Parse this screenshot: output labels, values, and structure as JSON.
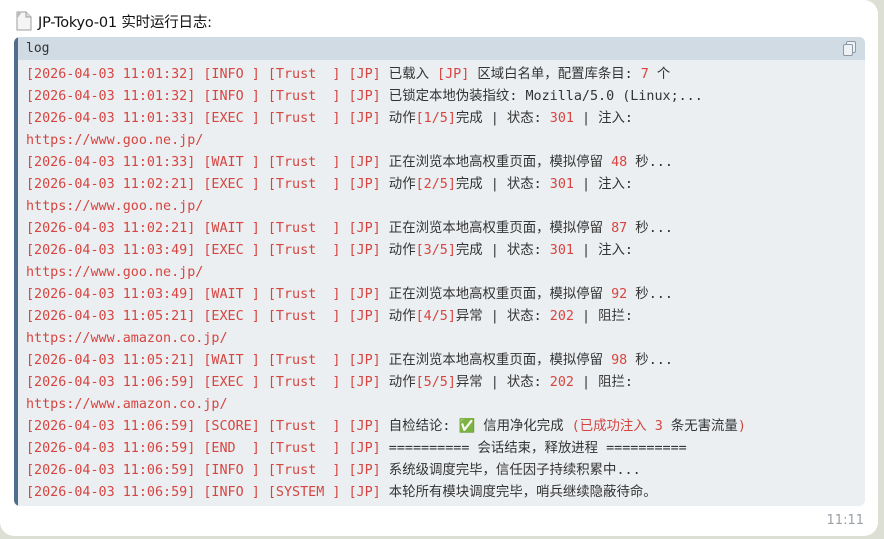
{
  "message": {
    "title": "JP-Tokyo-01 实时运行日志:",
    "timestamp": "11:11",
    "icon": "file-icon"
  },
  "code": {
    "language": "log",
    "copy_icon": "copy-icon",
    "lines": [
      {
        "parts": [
          [
            "b",
            "[2026-04-03 11:01:32]"
          ],
          [
            "t",
            " "
          ],
          [
            "b",
            "[INFO ]"
          ],
          [
            "t",
            " "
          ],
          [
            "b",
            "[Trust  ]"
          ],
          [
            "t",
            " "
          ],
          [
            "b",
            "[JP]"
          ],
          [
            "t",
            " 已载入 "
          ],
          [
            "b",
            "[JP]"
          ],
          [
            "t",
            " 区域白名单，配置库条目: "
          ],
          [
            "n",
            "7"
          ],
          [
            "t",
            " 个"
          ]
        ]
      },
      {
        "parts": [
          [
            "b",
            "[2026-04-03 11:01:32]"
          ],
          [
            "t",
            " "
          ],
          [
            "b",
            "[INFO ]"
          ],
          [
            "t",
            " "
          ],
          [
            "b",
            "[Trust  ]"
          ],
          [
            "t",
            " "
          ],
          [
            "b",
            "[JP]"
          ],
          [
            "t",
            " 已锁定本地伪装指纹: Mozilla/5.0 (Linux;..."
          ]
        ]
      },
      {
        "parts": [
          [
            "b",
            "[2026-04-03 11:01:33]"
          ],
          [
            "t",
            " "
          ],
          [
            "b",
            "[EXEC ]"
          ],
          [
            "t",
            " "
          ],
          [
            "b",
            "[Trust  ]"
          ],
          [
            "t",
            " "
          ],
          [
            "b",
            "[JP]"
          ],
          [
            "t",
            " 动作"
          ],
          [
            "b",
            "[1/5]"
          ],
          [
            "t",
            "完成 | 状态: "
          ],
          [
            "n",
            "301"
          ],
          [
            "t",
            " | 注入:"
          ]
        ]
      },
      {
        "parts": [
          [
            "u",
            "https://www.goo.ne.jp/"
          ]
        ]
      },
      {
        "parts": [
          [
            "b",
            "[2026-04-03 11:01:33]"
          ],
          [
            "t",
            " "
          ],
          [
            "b",
            "[WAIT ]"
          ],
          [
            "t",
            " "
          ],
          [
            "b",
            "[Trust  ]"
          ],
          [
            "t",
            " "
          ],
          [
            "b",
            "[JP]"
          ],
          [
            "t",
            " 正在浏览本地高权重页面，模拟停留 "
          ],
          [
            "n",
            "48"
          ],
          [
            "t",
            " 秒..."
          ]
        ]
      },
      {
        "parts": [
          [
            "b",
            "[2026-04-03 11:02:21]"
          ],
          [
            "t",
            " "
          ],
          [
            "b",
            "[EXEC ]"
          ],
          [
            "t",
            " "
          ],
          [
            "b",
            "[Trust  ]"
          ],
          [
            "t",
            " "
          ],
          [
            "b",
            "[JP]"
          ],
          [
            "t",
            " 动作"
          ],
          [
            "b",
            "[2/5]"
          ],
          [
            "t",
            "完成 | 状态: "
          ],
          [
            "n",
            "301"
          ],
          [
            "t",
            " | 注入:"
          ]
        ]
      },
      {
        "parts": [
          [
            "u",
            "https://www.goo.ne.jp/"
          ]
        ]
      },
      {
        "parts": [
          [
            "b",
            "[2026-04-03 11:02:21]"
          ],
          [
            "t",
            " "
          ],
          [
            "b",
            "[WAIT ]"
          ],
          [
            "t",
            " "
          ],
          [
            "b",
            "[Trust  ]"
          ],
          [
            "t",
            " "
          ],
          [
            "b",
            "[JP]"
          ],
          [
            "t",
            " 正在浏览本地高权重页面，模拟停留 "
          ],
          [
            "n",
            "87"
          ],
          [
            "t",
            " 秒..."
          ]
        ]
      },
      {
        "parts": [
          [
            "b",
            "[2026-04-03 11:03:49]"
          ],
          [
            "t",
            " "
          ],
          [
            "b",
            "[EXEC ]"
          ],
          [
            "t",
            " "
          ],
          [
            "b",
            "[Trust  ]"
          ],
          [
            "t",
            " "
          ],
          [
            "b",
            "[JP]"
          ],
          [
            "t",
            " 动作"
          ],
          [
            "b",
            "[3/5]"
          ],
          [
            "t",
            "完成 | 状态: "
          ],
          [
            "n",
            "301"
          ],
          [
            "t",
            " | 注入:"
          ]
        ]
      },
      {
        "parts": [
          [
            "u",
            "https://www.goo.ne.jp/"
          ]
        ]
      },
      {
        "parts": [
          [
            "b",
            "[2026-04-03 11:03:49]"
          ],
          [
            "t",
            " "
          ],
          [
            "b",
            "[WAIT ]"
          ],
          [
            "t",
            " "
          ],
          [
            "b",
            "[Trust  ]"
          ],
          [
            "t",
            " "
          ],
          [
            "b",
            "[JP]"
          ],
          [
            "t",
            " 正在浏览本地高权重页面，模拟停留 "
          ],
          [
            "n",
            "92"
          ],
          [
            "t",
            " 秒..."
          ]
        ]
      },
      {
        "parts": [
          [
            "b",
            "[2026-04-03 11:05:21]"
          ],
          [
            "t",
            " "
          ],
          [
            "b",
            "[EXEC ]"
          ],
          [
            "t",
            " "
          ],
          [
            "b",
            "[Trust  ]"
          ],
          [
            "t",
            " "
          ],
          [
            "b",
            "[JP]"
          ],
          [
            "t",
            " 动作"
          ],
          [
            "b",
            "[4/5]"
          ],
          [
            "t",
            "异常 | 状态: "
          ],
          [
            "n",
            "202"
          ],
          [
            "t",
            " | 阻拦:"
          ]
        ]
      },
      {
        "parts": [
          [
            "u",
            "https://www.amazon.co.jp/"
          ]
        ]
      },
      {
        "parts": [
          [
            "b",
            "[2026-04-03 11:05:21]"
          ],
          [
            "t",
            " "
          ],
          [
            "b",
            "[WAIT ]"
          ],
          [
            "t",
            " "
          ],
          [
            "b",
            "[Trust  ]"
          ],
          [
            "t",
            " "
          ],
          [
            "b",
            "[JP]"
          ],
          [
            "t",
            " 正在浏览本地高权重页面，模拟停留 "
          ],
          [
            "n",
            "98"
          ],
          [
            "t",
            " 秒..."
          ]
        ]
      },
      {
        "parts": [
          [
            "b",
            "[2026-04-03 11:06:59]"
          ],
          [
            "t",
            " "
          ],
          [
            "b",
            "[EXEC ]"
          ],
          [
            "t",
            " "
          ],
          [
            "b",
            "[Trust  ]"
          ],
          [
            "t",
            " "
          ],
          [
            "b",
            "[JP]"
          ],
          [
            "t",
            " 动作"
          ],
          [
            "b",
            "[5/5]"
          ],
          [
            "t",
            "异常 | 状态: "
          ],
          [
            "n",
            "202"
          ],
          [
            "t",
            " | 阻拦:"
          ]
        ]
      },
      {
        "parts": [
          [
            "u",
            "https://www.amazon.co.jp/"
          ]
        ]
      },
      {
        "parts": [
          [
            "b",
            "[2026-04-03 11:06:59]"
          ],
          [
            "t",
            " "
          ],
          [
            "b",
            "[SCORE]"
          ],
          [
            "t",
            " "
          ],
          [
            "b",
            "[Trust  ]"
          ],
          [
            "t",
            " "
          ],
          [
            "b",
            "[JP]"
          ],
          [
            "t",
            " 自检结论: "
          ],
          [
            "e",
            "✅"
          ],
          [
            "t",
            " 信用净化完成 "
          ],
          [
            "b",
            "(已成功注入 "
          ],
          [
            "n",
            "3"
          ],
          [
            "t",
            " 条无害流量"
          ],
          [
            "b",
            ")"
          ]
        ]
      },
      {
        "parts": [
          [
            "b",
            "[2026-04-03 11:06:59]"
          ],
          [
            "t",
            " "
          ],
          [
            "b",
            "[END  ]"
          ],
          [
            "t",
            " "
          ],
          [
            "b",
            "[Trust  ]"
          ],
          [
            "t",
            " "
          ],
          [
            "b",
            "[JP]"
          ],
          [
            "t",
            " ========== 会话结束，释放进程 =========="
          ]
        ]
      },
      {
        "parts": [
          [
            "b",
            "[2026-04-03 11:06:59]"
          ],
          [
            "t",
            " "
          ],
          [
            "b",
            "[INFO ]"
          ],
          [
            "t",
            " "
          ],
          [
            "b",
            "[Trust  ]"
          ],
          [
            "t",
            " "
          ],
          [
            "b",
            "[JP]"
          ],
          [
            "t",
            " 系统级调度完毕，信任因子持续积累中..."
          ]
        ]
      },
      {
        "parts": [
          [
            "b",
            "[2026-04-03 11:06:59]"
          ],
          [
            "t",
            " "
          ],
          [
            "b",
            "[INFO ]"
          ],
          [
            "t",
            " "
          ],
          [
            "b",
            "[SYSTEM ]"
          ],
          [
            "t",
            " "
          ],
          [
            "b",
            "[JP]"
          ],
          [
            "t",
            " 本轮所有模块调度完毕，哨兵继续隐蔽待命。"
          ]
        ]
      }
    ]
  }
}
